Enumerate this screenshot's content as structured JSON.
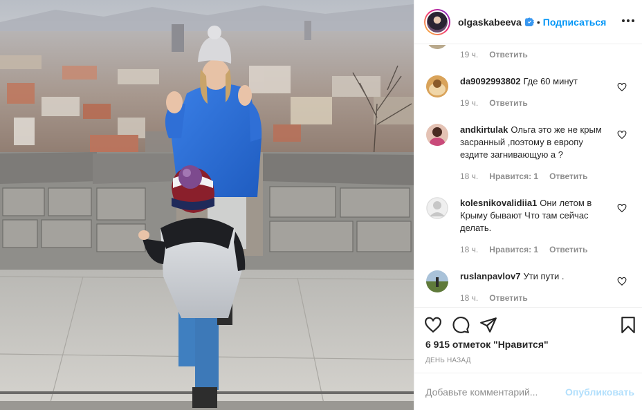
{
  "header": {
    "username": "olgaskabeeva",
    "separator": "•",
    "follow_label": "Подписаться"
  },
  "comments": {
    "first_meta": {
      "time": "19 ч.",
      "reply": "Ответить"
    },
    "items": [
      {
        "username": "da9092993802",
        "text": "Где 60 минут",
        "time": "19 ч.",
        "likes": "",
        "reply": "Ответить"
      },
      {
        "username": "andkirtulak",
        "text": "Ольга это же не крым засранный ,поэтому в европу ездите загнивающую а ?",
        "time": "18 ч.",
        "likes": "Нравится: 1",
        "reply": "Ответить"
      },
      {
        "username": "kolesnikovalidiia1",
        "text": "Они летом в Крыму бывают Что там сейчас делать.",
        "time": "18 ч.",
        "likes": "Нравится: 1",
        "reply": "Ответить"
      },
      {
        "username": "ruslanpavlov7",
        "text": "Ути пути .",
        "time": "18 ч.",
        "likes": "",
        "reply": "Ответить"
      }
    ]
  },
  "actions": {
    "likes_text": "6 915 отметок \"Нравится\"",
    "date": "ДЕНЬ НАЗАД"
  },
  "add_comment": {
    "placeholder": "Добавьте комментарий...",
    "publish_label": "Опубликовать"
  },
  "icons": {
    "verified": "verified-badge-icon",
    "more": "more-options-icon",
    "like": "heart-icon",
    "comment": "comment-icon",
    "share": "share-icon",
    "save": "bookmark-icon"
  },
  "colors": {
    "accent": "#0095f6",
    "publish_disabled": "#b2dffc",
    "muted": "#8e8e8e",
    "text": "#262626",
    "jacket_blue": "#2f6fd6"
  }
}
